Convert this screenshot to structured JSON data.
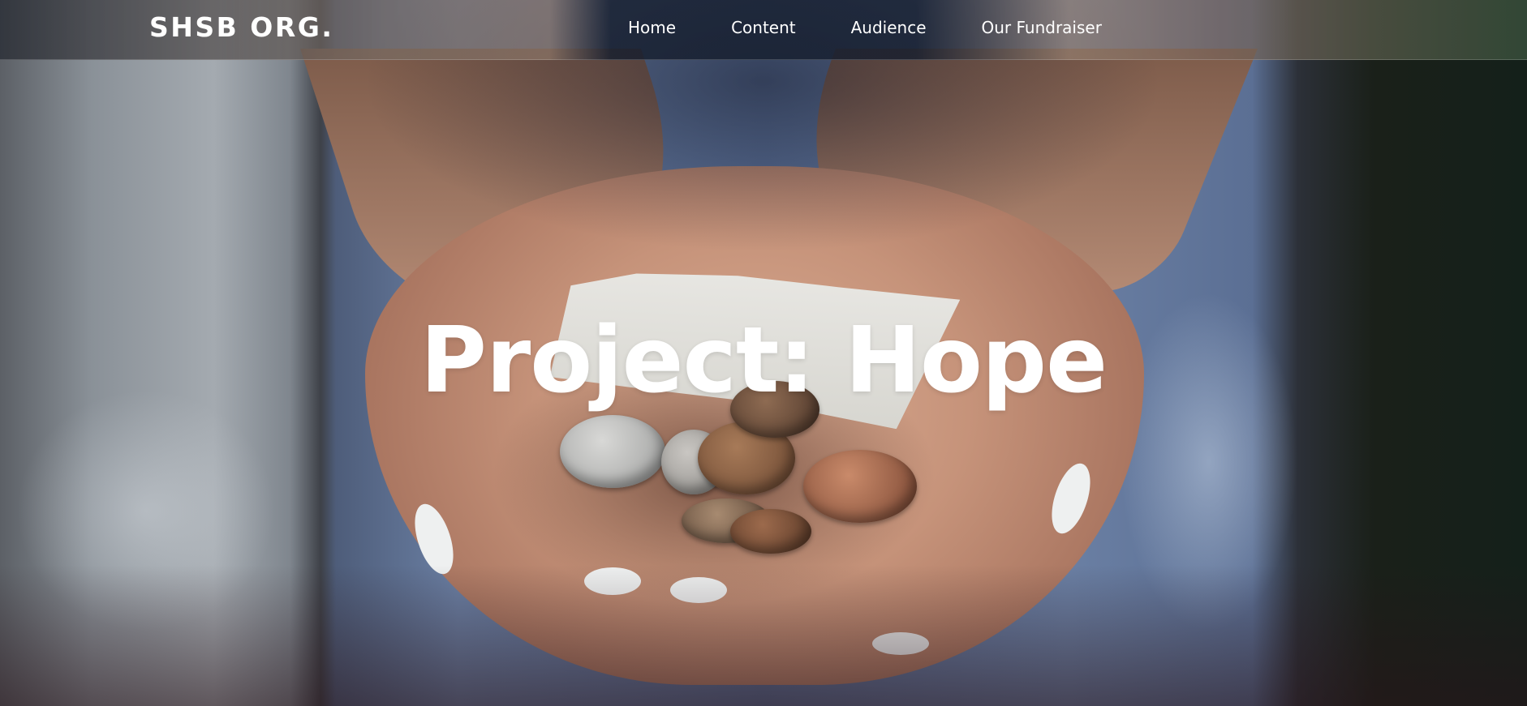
{
  "navbar": {
    "brand": "SHSB ORG.",
    "links": [
      {
        "label": "Home"
      },
      {
        "label": "Content"
      },
      {
        "label": "Audience"
      },
      {
        "label": "Our Fundraiser"
      }
    ]
  },
  "hero": {
    "title": "Project: Hope",
    "image_description_icon": "hands-holding-coins-photo"
  },
  "colors": {
    "text": "#ffffff",
    "navbar_tint": "#1a2233"
  }
}
